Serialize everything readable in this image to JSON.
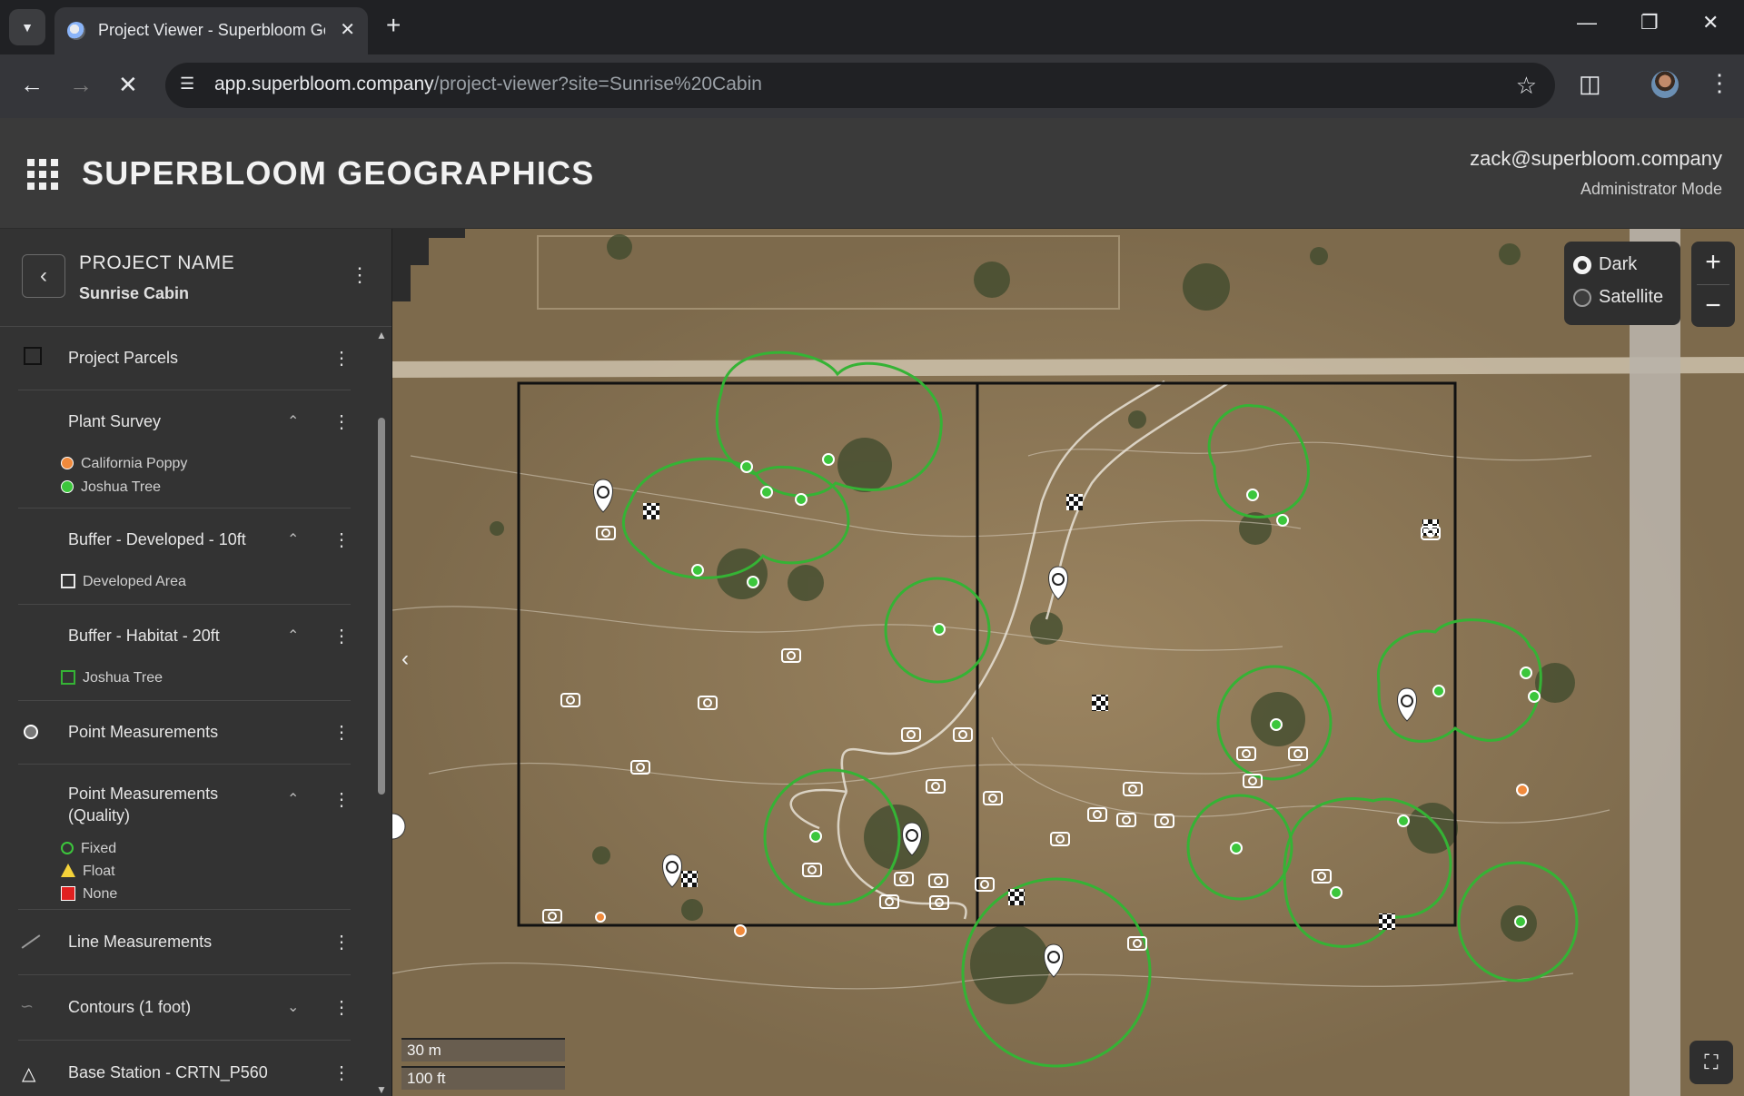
{
  "browser": {
    "tab_title": "Project Viewer - Superbloom Geographics",
    "url_host": "app.superbloom.company",
    "url_path": "/project-viewer?site=Sunrise%20Cabin"
  },
  "header": {
    "brand": "SUPERBLOOM GEOGRAPHICS",
    "user_email": "zack@superbloom.company",
    "user_mode": "Administrator Mode"
  },
  "project": {
    "label": "PROJECT NAME",
    "name": "Sunrise Cabin"
  },
  "layers": {
    "parcels": "Project Parcels",
    "plant_survey": "Plant Survey",
    "plant_legend": [
      "California Poppy",
      "Joshua Tree"
    ],
    "buffer_dev": "Buffer - Developed - 10ft",
    "buffer_dev_legend": "Developed Area",
    "buffer_habitat": "Buffer - Habitat - 20ft",
    "buffer_habitat_legend": "Joshua Tree",
    "point_meas": "Point Measurements",
    "point_quality": "Point Measurements (Quality)",
    "quality_legend": [
      "Fixed",
      "Float",
      "None"
    ],
    "line_meas": "Line Measurements",
    "contours": "Contours (1 foot)",
    "base_station": "Base Station - CRTN_P560"
  },
  "map": {
    "basemap_options": [
      "Dark",
      "Satellite"
    ],
    "basemap_selected": "Dark",
    "scale_metric": "30 m",
    "scale_imperial": "100 ft"
  },
  "colors": {
    "poppy": "#f08a3c",
    "joshua_tree": "#3cc63c",
    "buffer_green": "#35b335",
    "quality_none": "#e02020",
    "quality_float": "#f5d33a"
  }
}
